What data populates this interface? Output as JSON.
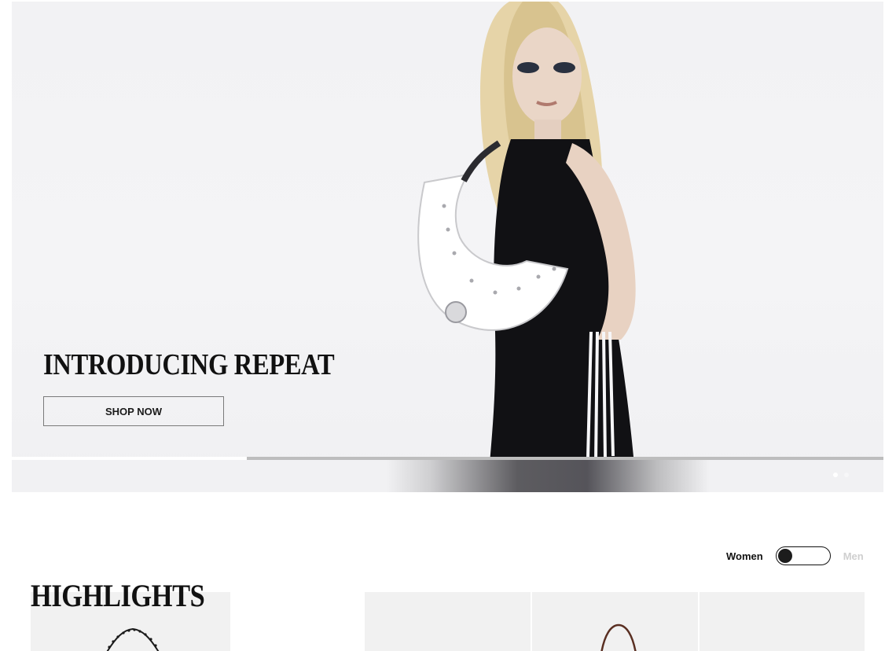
{
  "hero": {
    "title": "INTRODUCING REPEAT",
    "cta_label": "SHOP NOW",
    "progress": 0.27,
    "slide_count": 2,
    "active_slide": 1,
    "image": "model-with-white-studded-hobo-bag"
  },
  "gender_toggle": {
    "women_label": "Women",
    "men_label": "Men",
    "selected": "Women"
  },
  "highlights": {
    "title": "HIGHLIGHTS",
    "tiles": [
      {
        "image": "studded-chain-bag"
      },
      {
        "image": "blank"
      },
      {
        "image": "brown-handle-bag"
      },
      {
        "image": "blank"
      }
    ]
  },
  "colors": {
    "hero_background": "#f2f2f4",
    "text": "#111111",
    "inactive_text": "#cfcfcf",
    "progress_track": "#bdbdbd",
    "progress_fill": "#ffffff",
    "tile_background": "#f1f1f1"
  }
}
